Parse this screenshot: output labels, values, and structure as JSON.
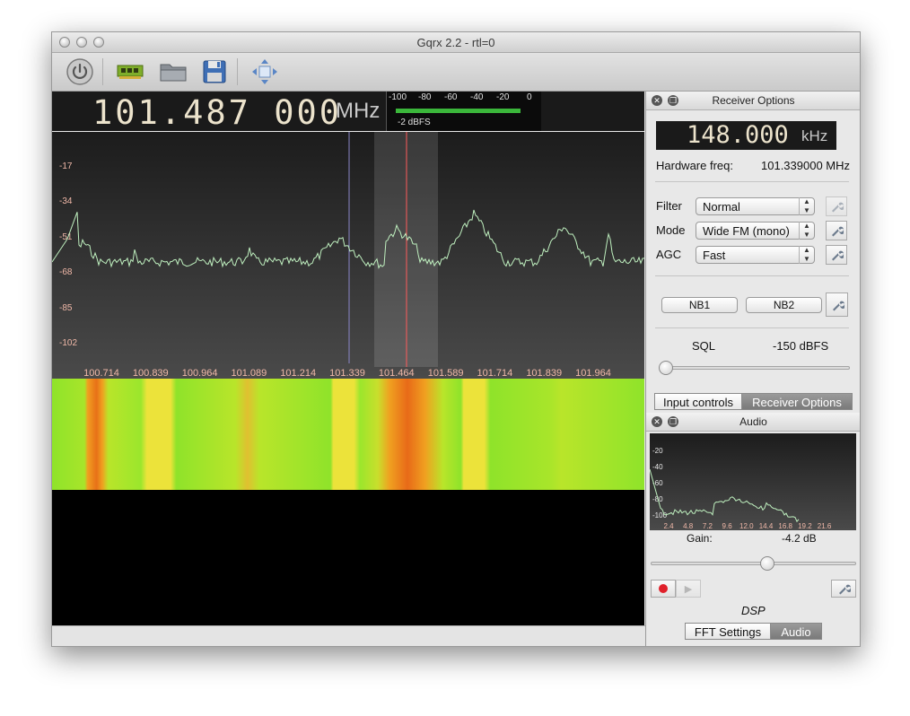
{
  "window": {
    "title": "Gqrx 2.2 - rtl=0"
  },
  "toolbar": {
    "icons": [
      "power-icon",
      "hardware-board-icon",
      "folder-open-icon",
      "floppy-save-icon",
      "move-arrows-icon"
    ]
  },
  "frequency": {
    "display": "101.487 000",
    "unit": "MHz"
  },
  "level_meter": {
    "ticks": [
      "-100",
      "-80",
      "-60",
      "-40",
      "-20",
      "0"
    ],
    "reading": "-2 dBFS",
    "level_fraction": 0.98,
    "bar_color": "#3bb73b"
  },
  "spectrum": {
    "y_labels": [
      "-17",
      "-34",
      "-51",
      "-68",
      "-85",
      "-102"
    ],
    "x_labels": [
      "100.714",
      "100.839",
      "100.964",
      "101.089",
      "101.214",
      "101.339",
      "101.464",
      "101.589",
      "101.714",
      "101.839",
      "101.964"
    ],
    "trace_color": "#bff0bf"
  },
  "receiver_options": {
    "dock_title": "Receiver Options",
    "offset": "148.000",
    "offset_unit": "kHz",
    "hw_freq_label": "Hardware freq:",
    "hw_freq_value": "101.339000 MHz",
    "filter_label": "Filter",
    "filter_value": "Normal",
    "mode_label": "Mode",
    "mode_value": "Wide FM (mono)",
    "agc_label": "AGC",
    "agc_value": "Fast",
    "nb1": "NB1",
    "nb2": "NB2",
    "sql_label": "SQL",
    "sql_value": "-150 dBFS",
    "tabs": [
      "Input controls",
      "Receiver Options"
    ]
  },
  "audio": {
    "dock_title": "Audio",
    "y_labels": [
      "-20",
      "-40",
      "-60",
      "-80",
      "-100"
    ],
    "x_labels": [
      "2.4",
      "4.8",
      "7.2",
      "9.6",
      "12.0",
      "14.4",
      "16.8",
      "19.2",
      "21.6"
    ],
    "gain_label": "Gain:",
    "gain_value": "-4.2 dB",
    "dsp_label": "DSP",
    "tabs": [
      "FFT Settings",
      "Audio"
    ]
  }
}
